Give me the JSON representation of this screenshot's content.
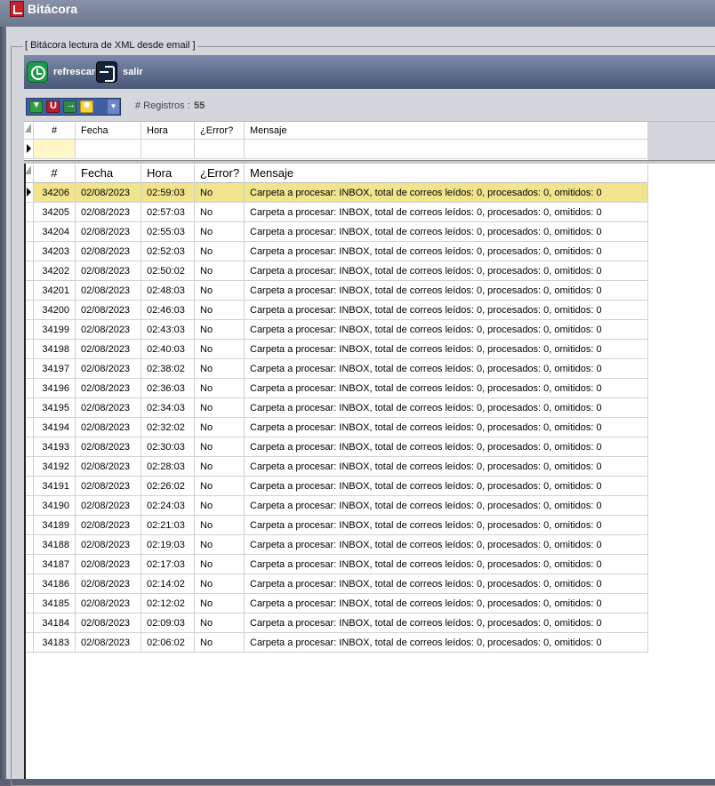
{
  "window": {
    "title": "Bitácora"
  },
  "group": {
    "title": "[ Bitácora lectura de XML desde email ]"
  },
  "toolbar": {
    "refresh_label": "refrescar",
    "exit_label": "salir"
  },
  "records": {
    "label": "# Registros :",
    "count": "55"
  },
  "columns": {
    "num": "#",
    "fecha": "Fecha",
    "hora": "Hora",
    "error": "¿Error?",
    "mensaje": "Mensaje"
  },
  "rows": [
    {
      "num": "34206",
      "fecha": "02/08/2023",
      "hora": "02:59:03",
      "error": "No",
      "mensaje": "Carpeta a procesar: INBOX, total de correos leídos: 0, procesados: 0, omitidos: 0"
    },
    {
      "num": "34205",
      "fecha": "02/08/2023",
      "hora": "02:57:03",
      "error": "No",
      "mensaje": "Carpeta a procesar: INBOX, total de correos leídos: 0, procesados: 0, omitidos: 0"
    },
    {
      "num": "34204",
      "fecha": "02/08/2023",
      "hora": "02:55:03",
      "error": "No",
      "mensaje": "Carpeta a procesar: INBOX, total de correos leídos: 0, procesados: 0, omitidos: 0"
    },
    {
      "num": "34203",
      "fecha": "02/08/2023",
      "hora": "02:52:03",
      "error": "No",
      "mensaje": "Carpeta a procesar: INBOX, total de correos leídos: 0, procesados: 0, omitidos: 0"
    },
    {
      "num": "34202",
      "fecha": "02/08/2023",
      "hora": "02:50:02",
      "error": "No",
      "mensaje": "Carpeta a procesar: INBOX, total de correos leídos: 0, procesados: 0, omitidos: 0"
    },
    {
      "num": "34201",
      "fecha": "02/08/2023",
      "hora": "02:48:03",
      "error": "No",
      "mensaje": "Carpeta a procesar: INBOX, total de correos leídos: 0, procesados: 0, omitidos: 0"
    },
    {
      "num": "34200",
      "fecha": "02/08/2023",
      "hora": "02:46:03",
      "error": "No",
      "mensaje": "Carpeta a procesar: INBOX, total de correos leídos: 0, procesados: 0, omitidos: 0"
    },
    {
      "num": "34199",
      "fecha": "02/08/2023",
      "hora": "02:43:03",
      "error": "No",
      "mensaje": "Carpeta a procesar: INBOX, total de correos leídos: 0, procesados: 0, omitidos: 0"
    },
    {
      "num": "34198",
      "fecha": "02/08/2023",
      "hora": "02:40:03",
      "error": "No",
      "mensaje": "Carpeta a procesar: INBOX, total de correos leídos: 0, procesados: 0, omitidos: 0"
    },
    {
      "num": "34197",
      "fecha": "02/08/2023",
      "hora": "02:38:02",
      "error": "No",
      "mensaje": "Carpeta a procesar: INBOX, total de correos leídos: 0, procesados: 0, omitidos: 0"
    },
    {
      "num": "34196",
      "fecha": "02/08/2023",
      "hora": "02:36:03",
      "error": "No",
      "mensaje": "Carpeta a procesar: INBOX, total de correos leídos: 0, procesados: 0, omitidos: 0"
    },
    {
      "num": "34195",
      "fecha": "02/08/2023",
      "hora": "02:34:03",
      "error": "No",
      "mensaje": "Carpeta a procesar: INBOX, total de correos leídos: 0, procesados: 0, omitidos: 0"
    },
    {
      "num": "34194",
      "fecha": "02/08/2023",
      "hora": "02:32:02",
      "error": "No",
      "mensaje": "Carpeta a procesar: INBOX, total de correos leídos: 0, procesados: 0, omitidos: 0"
    },
    {
      "num": "34193",
      "fecha": "02/08/2023",
      "hora": "02:30:03",
      "error": "No",
      "mensaje": "Carpeta a procesar: INBOX, total de correos leídos: 0, procesados: 0, omitidos: 0"
    },
    {
      "num": "34192",
      "fecha": "02/08/2023",
      "hora": "02:28:03",
      "error": "No",
      "mensaje": "Carpeta a procesar: INBOX, total de correos leídos: 0, procesados: 0, omitidos: 0"
    },
    {
      "num": "34191",
      "fecha": "02/08/2023",
      "hora": "02:26:02",
      "error": "No",
      "mensaje": "Carpeta a procesar: INBOX, total de correos leídos: 0, procesados: 0, omitidos: 0"
    },
    {
      "num": "34190",
      "fecha": "02/08/2023",
      "hora": "02:24:03",
      "error": "No",
      "mensaje": "Carpeta a procesar: INBOX, total de correos leídos: 0, procesados: 0, omitidos: 0"
    },
    {
      "num": "34189",
      "fecha": "02/08/2023",
      "hora": "02:21:03",
      "error": "No",
      "mensaje": "Carpeta a procesar: INBOX, total de correos leídos: 0, procesados: 0, omitidos: 0"
    },
    {
      "num": "34188",
      "fecha": "02/08/2023",
      "hora": "02:19:03",
      "error": "No",
      "mensaje": "Carpeta a procesar: INBOX, total de correos leídos: 0, procesados: 0, omitidos: 0"
    },
    {
      "num": "34187",
      "fecha": "02/08/2023",
      "hora": "02:17:03",
      "error": "No",
      "mensaje": "Carpeta a procesar: INBOX, total de correos leídos: 0, procesados: 0, omitidos: 0"
    },
    {
      "num": "34186",
      "fecha": "02/08/2023",
      "hora": "02:14:02",
      "error": "No",
      "mensaje": "Carpeta a procesar: INBOX, total de correos leídos: 0, procesados: 0, omitidos: 0"
    },
    {
      "num": "34185",
      "fecha": "02/08/2023",
      "hora": "02:12:02",
      "error": "No",
      "mensaje": "Carpeta a procesar: INBOX, total de correos leídos: 0, procesados: 0, omitidos: 0"
    },
    {
      "num": "34184",
      "fecha": "02/08/2023",
      "hora": "02:09:03",
      "error": "No",
      "mensaje": "Carpeta a procesar: INBOX, total de correos leídos: 0, procesados: 0, omitidos: 0"
    },
    {
      "num": "34183",
      "fecha": "02/08/2023",
      "hora": "02:06:02",
      "error": "No",
      "mensaje": "Carpeta a procesar: INBOX, total de correos leídos: 0, procesados: 0, omitidos: 0"
    }
  ]
}
